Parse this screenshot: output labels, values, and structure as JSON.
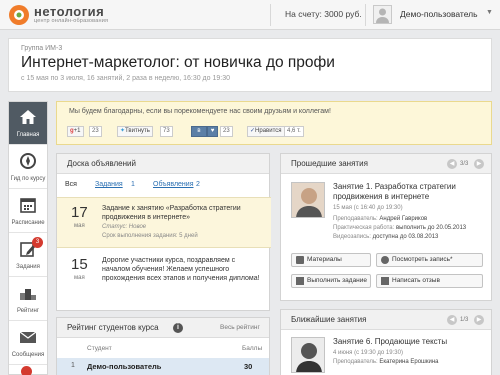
{
  "header": {
    "brand": "нетология",
    "brand_sub": "центр онлайн-образования",
    "balance": "На счету: 3000 руб.",
    "user": "Демо-пользователь"
  },
  "course": {
    "group": "Группа ИМ-3",
    "title": "Интернет-маркетолог: от новичка до профи",
    "dates": "с 15 мая по 3 июля, 16 занятий, 2 раза в неделю, 16:30 до 19:30"
  },
  "nav": {
    "items": [
      {
        "label": "Главная",
        "icon": "home-icon"
      },
      {
        "label": "Гид по курсу",
        "icon": "compass-icon"
      },
      {
        "label": "Расписание",
        "icon": "calendar-icon"
      },
      {
        "label": "Задания",
        "icon": "pencil-icon",
        "badge": "3"
      },
      {
        "label": "Рейтинг",
        "icon": "podium-icon"
      },
      {
        "label": "Сообщения",
        "icon": "envelope-icon"
      }
    ]
  },
  "notice": {
    "text": "Мы будем благодарны, если вы порекомендуете нас своим друзьям и коллегам!",
    "shares": [
      {
        "label": "+1",
        "count": "23"
      },
      {
        "label": "Твитнуть",
        "count": "73"
      },
      {
        "label": "в",
        "count": "23"
      },
      {
        "label": "Нравится",
        "count": "4,6 т."
      }
    ]
  },
  "board": {
    "title": "Доска объявлений",
    "tab_all": "Вся",
    "tab_tasks": "Задания",
    "tab_tasks_count": "1",
    "tab_news": "Объявления",
    "tab_news_count": "2",
    "items": [
      {
        "day": "17",
        "month": "мая",
        "title": "Задание к занятию «Разработка стратегии продвижения в интернете»",
        "status": "Статус: Новое",
        "due": "Срок выполнения задания: 5 дней"
      },
      {
        "day": "15",
        "month": "мая",
        "title": "Дорогие участники курса, поздравляем с началом обучения! Желаем успешного прохождения всех этапов и получения диплома!"
      }
    ]
  },
  "rating": {
    "title": "Рейтинг студентов курса",
    "all_link": "Весь рейтинг",
    "col_student": "Студент",
    "col_points": "Баллы",
    "rows": [
      {
        "rank": "1",
        "name": "Демо-пользователь",
        "points": "30"
      }
    ]
  },
  "past": {
    "title": "Прошедшие занятия",
    "pager": "3/3",
    "lesson_title": "Занятие 1. Разработка стратегии продвижения в интернете",
    "lesson_date": "15 мая (с 16:40 до 19:30)",
    "teacher_label": "Преподаватель:",
    "teacher": "Андрей Гавриков",
    "practice_label": "Практическая работа:",
    "practice": "выполнить до 20.05.2013",
    "video_label": "Видеозапись:",
    "video": "доступна до 03.08.2013",
    "buttons": [
      "Материалы",
      "Посмотреть запись*",
      "Выполнить задание",
      "Написать отзыв"
    ]
  },
  "upcoming": {
    "title": "Ближайшие занятия",
    "pager": "1/3",
    "lesson_title": "Занятие 6. Продающие тексты",
    "lesson_date": "4 июня (с 19:30 до 19:30)",
    "teacher_label": "Преподаватель:",
    "teacher": "Екатерина Ерошкина"
  }
}
